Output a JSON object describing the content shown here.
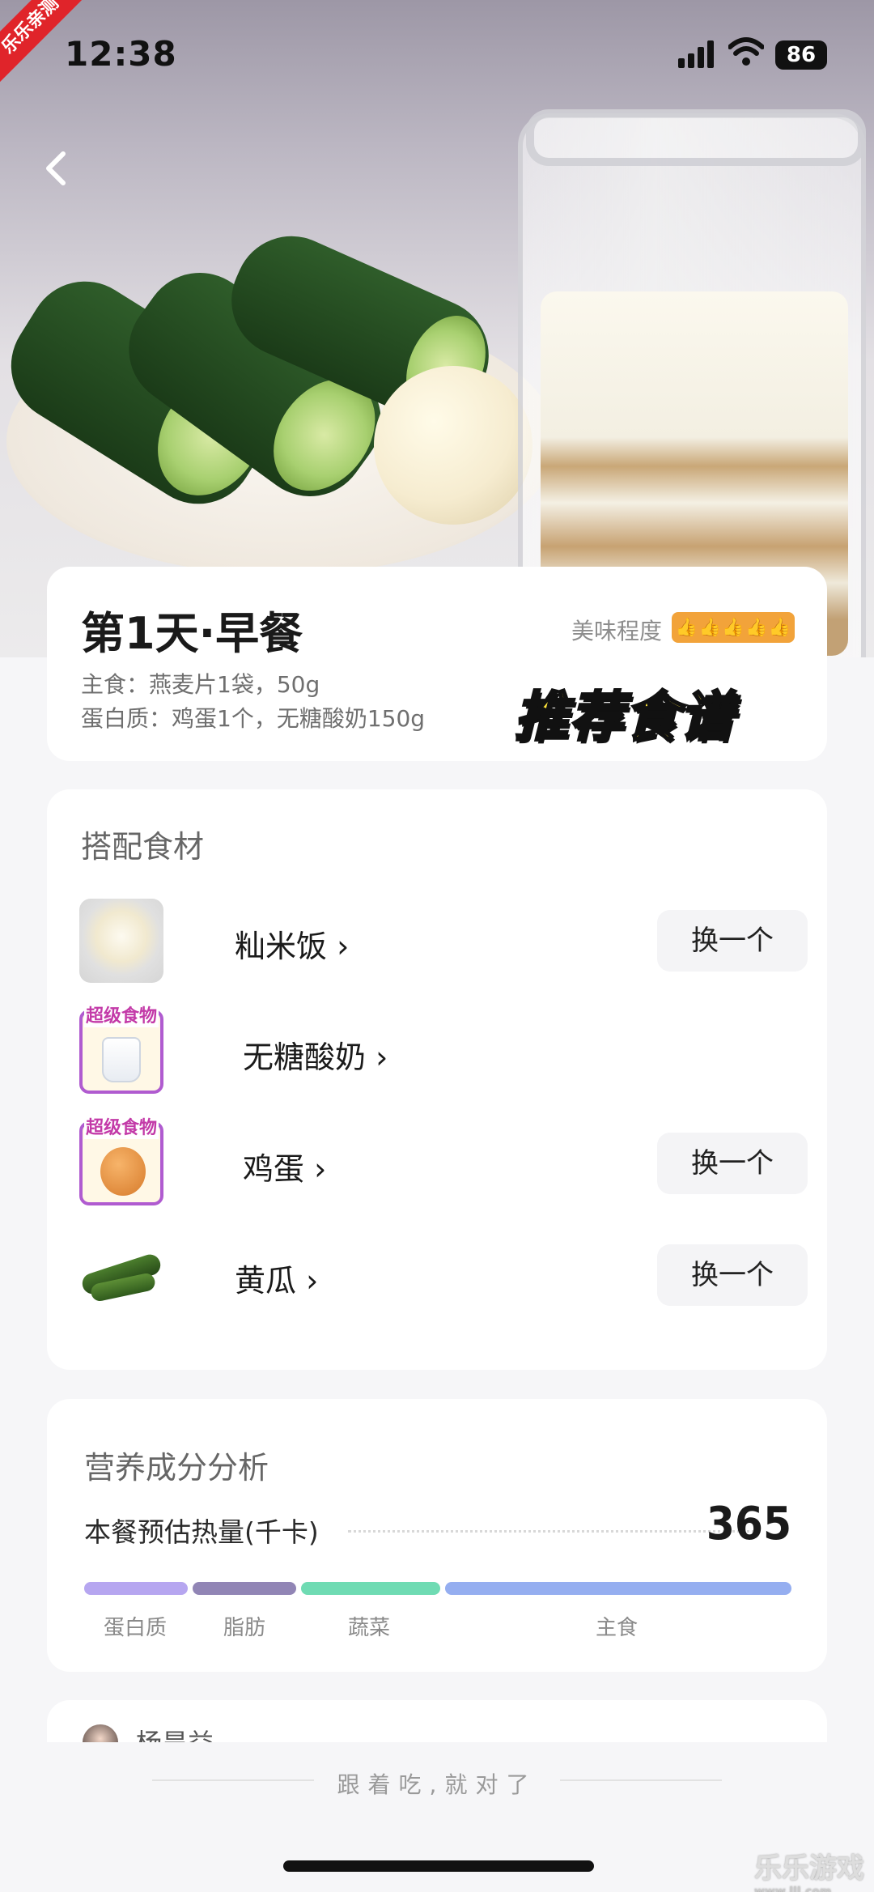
{
  "status": {
    "time": "12:38",
    "battery": "86"
  },
  "ribbon": "乐乐亲测",
  "meal": {
    "title": "第1天·早餐",
    "taste_label": "美味程度",
    "info_staple": "主食：燕麦片1袋，50g",
    "info_protein": "蛋白质：鸡蛋1个，无糖酸奶150g",
    "promo": "推荐食谱"
  },
  "ingredients": {
    "section_title": "搭配食材",
    "super_tag": "超级食物",
    "swap_label": "换一个",
    "items": [
      {
        "name": "籼米饭 ›"
      },
      {
        "name": "无糖酸奶 ›"
      },
      {
        "name": "鸡蛋 ›"
      },
      {
        "name": "黄瓜 ›"
      }
    ]
  },
  "nutrition": {
    "section_title": "营养成分分析",
    "kcal_label": "本餐预估热量(千卡)",
    "kcal_value": "365",
    "segments": [
      {
        "label": "蛋白质",
        "color": "#b6a6f0"
      },
      {
        "label": "脂肪",
        "color": "#9185b5"
      },
      {
        "label": "蔬菜",
        "color": "#6fdbb3"
      },
      {
        "label": "主食",
        "color": "#95aef0"
      }
    ]
  },
  "author": {
    "name": "杨昊益"
  },
  "footer": {
    "slogan": "跟着吃,就对了"
  },
  "watermark": {
    "title": "乐乐游戏",
    "url": "www.lll.com"
  }
}
